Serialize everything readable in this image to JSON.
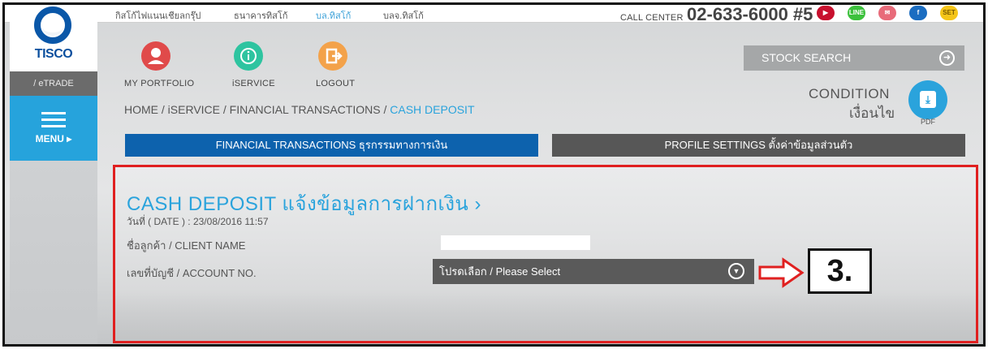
{
  "top_links": [
    "กิสโก้ไฟแนนเชียลกรุ๊ป",
    "ธนาคารทิสโก้",
    "บล.ทิสโก้",
    "บลจ.ทิสโก้"
  ],
  "active_top_link": "บล.ทิสโก้",
  "call_center": {
    "label": "CALL CENTER",
    "number": "02-633-6000 #5"
  },
  "social_icons": [
    {
      "name": "youtube-icon",
      "glyph": "▶",
      "color": "#c8102e"
    },
    {
      "name": "line-icon",
      "glyph": "LINE",
      "color": "#3cc13c"
    },
    {
      "name": "email-icon",
      "glyph": "✉",
      "color": "#e86b7a"
    },
    {
      "name": "facebook-icon",
      "glyph": "f",
      "color": "#1b6dc1"
    },
    {
      "name": "set-icon",
      "glyph": "SET",
      "color": "#f5c518"
    }
  ],
  "sidebar": {
    "logo_text": "TISCO",
    "etrade": "/ eTRADE",
    "menu_label": "MENU ▸"
  },
  "nav_icons": [
    {
      "label": "MY PORTFOLIO",
      "icon": "user-icon",
      "color": "#e04a4a"
    },
    {
      "label": "iSERVICE",
      "icon": "info-icon",
      "color": "#2ec4a0"
    },
    {
      "label": "LOGOUT",
      "icon": "logout-icon",
      "color": "#f3a24a"
    }
  ],
  "breadcrumb": {
    "path": "HOME / iSERVICE / FINANCIAL TRANSACTIONS / ",
    "current": "CASH DEPOSIT"
  },
  "stock_search": "STOCK SEARCH",
  "condition": {
    "en": "CONDITION",
    "th": "เงื่อนไข",
    "pdf": "PDF"
  },
  "tabs": [
    {
      "label": "FINANCIAL TRANSACTIONS ธุรกรรมทางการเงิน",
      "active": true
    },
    {
      "label": "PROFILE SETTINGS ตั้งค่าข้อมูลส่วนตัว",
      "active": false
    }
  ],
  "form": {
    "title": "CASH DEPOSIT แจ้งข้อมูลการฝากเงิน ›",
    "date": "วันที่ ( DATE ) : 23/08/2016 11:57",
    "client_name_label": "ชื่อลูกค้า / CLIENT NAME",
    "client_name_value": "",
    "account_label": "เลขที่บัญชี / ACCOUNT NO.",
    "account_select": "โปรดเลือก / Please Select"
  },
  "annotation": {
    "step": "3."
  },
  "colors": {
    "accent_blue": "#2aa3dc",
    "tab_blue": "#0d62ad",
    "highlight_red": "#e02020"
  }
}
